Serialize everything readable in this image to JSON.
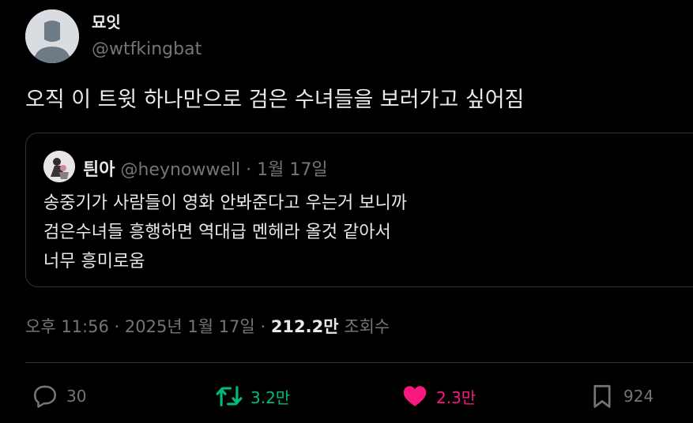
{
  "author": {
    "display_name": "묘잇",
    "handle": "@wtfkingbat"
  },
  "tweet": {
    "text": "오직 이 트윗 하나만으로 검은 수녀들을 보러가고 싶어짐"
  },
  "quote": {
    "name": "틘아",
    "handle": "@heynowwell",
    "separator": "·",
    "date": "1월 17일",
    "lines": [
      "송중기가 사람들이 영화 안봐준다고 우는거 보니까",
      "검은수녀들 흥행하면 역대급 멘헤라 올것 같아서",
      "너무 흥미로움"
    ]
  },
  "meta": {
    "time": "오후 11:56",
    "separator": "·",
    "date": "2025년 1월 17일",
    "views_separator": "·",
    "views_count": "212.2만",
    "views_label": "조회수"
  },
  "actions": {
    "replies": "30",
    "retweets": "3.2만",
    "likes": "2.3만",
    "bookmarks": "924"
  },
  "colors": {
    "background": "#000000",
    "text_primary": "#e7e9ea",
    "text_secondary": "#71767b",
    "border": "#2f3336",
    "retweet": "#00ba7c",
    "like": "#f91880"
  },
  "icons": {
    "reply": "speech-bubble-icon",
    "retweet": "retweet-arrows-icon",
    "like": "heart-filled-icon",
    "bookmark": "bookmark-icon"
  }
}
